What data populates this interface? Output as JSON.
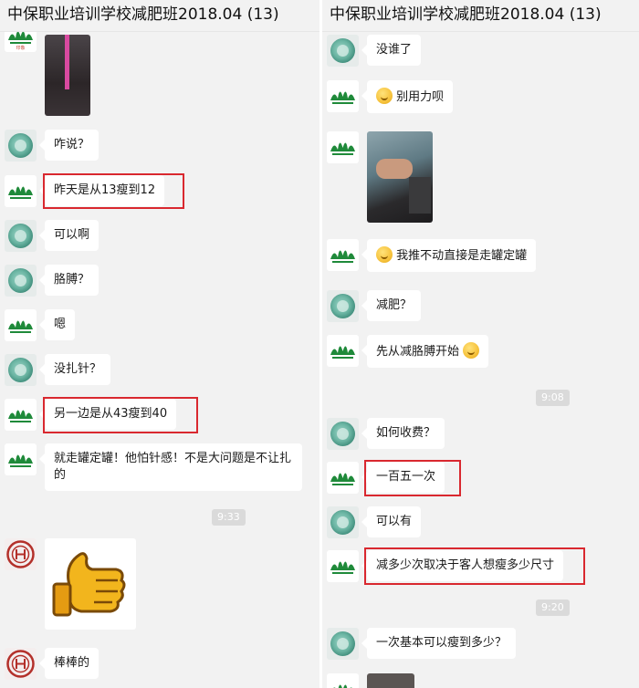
{
  "left": {
    "title": "中保职业培训学校减肥班2018.04 (13)",
    "messages": [
      "咋说？",
      "昨天是从13瘦到12",
      "可以啊",
      "胳膊？",
      "嗯",
      "没扎针？",
      "另一边是从43瘦到40",
      "就走罐定罐！他怕针感！不是大问题是不让扎的",
      "棒棒的"
    ],
    "time": "9:33"
  },
  "right": {
    "title": "中保职业培训学校减肥班2018.04 (13)",
    "messages": [
      "没谁了",
      "别用力呗",
      "我推不动直接是走罐定罐",
      "减肥？",
      "先从减胳膊开始",
      "如何收费？",
      "一百五一次",
      "可以有",
      "减多少次取决于客人想瘦多少尺寸",
      "一次基本可以瘦到多少？"
    ],
    "times": [
      "9:08",
      "9:20"
    ]
  },
  "colors": {
    "highlight": "#d9282f",
    "background": "#f2f2f2",
    "bubble": "#ffffff"
  },
  "icons": [
    "jade-avatar-icon",
    "lotus-logo-avatar-icon",
    "seal-avatar-icon",
    "emoji-icon",
    "thumbs-up-sticker"
  ]
}
